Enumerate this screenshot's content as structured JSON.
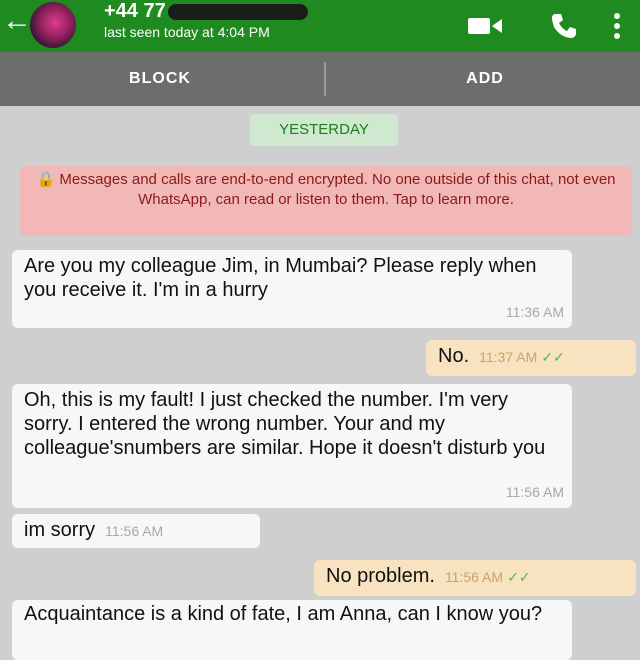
{
  "header": {
    "back_icon": "arrow-left-icon",
    "phone_prefix": "+44 77",
    "last_seen": "last seen today at 4:04 PM",
    "color": "#1f8a1f"
  },
  "actions": {
    "block_label": "BLOCK",
    "add_label": "ADD"
  },
  "date_label": "YESTERDAY",
  "encryption_notice": "Messages and calls are end-to-end encrypted. No one outside of this chat, not even WhatsApp, can read or listen to them. Tap to learn more.",
  "messages": [
    {
      "dir": "in",
      "text": "Are you my colleague Jim, in Mumbai? Please reply when you receive it. I'm in a hurry",
      "time": "11:36 AM"
    },
    {
      "dir": "out",
      "text": "No.",
      "time": "11:37 AM"
    },
    {
      "dir": "in",
      "text": "Oh, this is my fault! I just checked the number. I'm very sorry. I entered the wrong number. Your and my colleague'snumbers are similar. Hope it doesn't disturb you",
      "time": "11:56 AM"
    },
    {
      "dir": "in",
      "text": "im sorry",
      "time": "11:56 AM"
    },
    {
      "dir": "out",
      "text": "No problem.",
      "time": "11:56 AM"
    },
    {
      "dir": "in",
      "text": "Acquaintance is a kind of fate, I am Anna, can I know you?",
      "time": ""
    }
  ]
}
